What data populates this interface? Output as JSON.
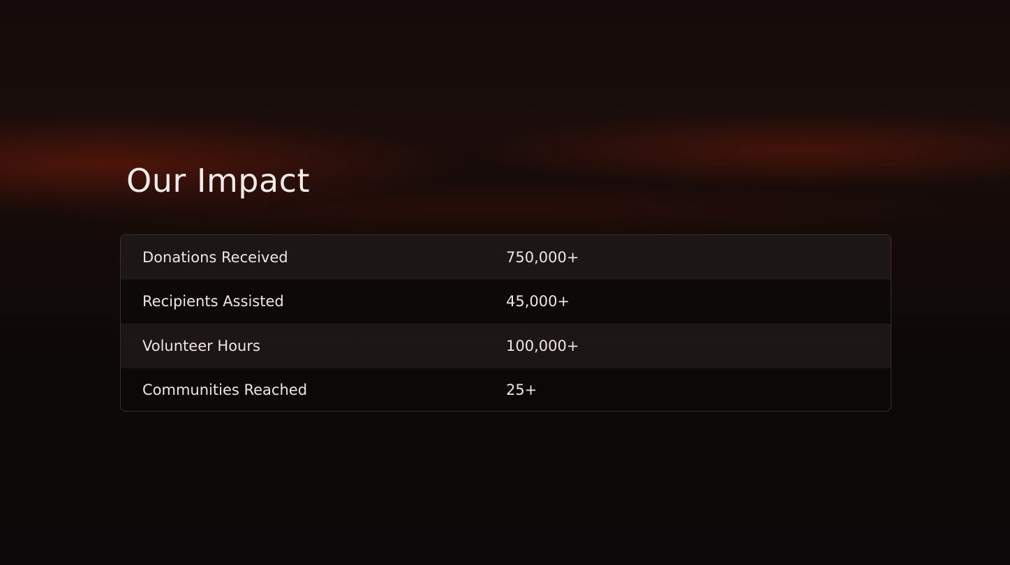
{
  "page": {
    "title": "Our Impact"
  },
  "impact_table": {
    "rows": [
      {
        "label": "Donations Received",
        "value": "750,000+"
      },
      {
        "label": "Recipients Assisted",
        "value": "45,000+"
      },
      {
        "label": "Volunteer Hours",
        "value": "100,000+"
      },
      {
        "label": "Communities Reached",
        "value": "25+"
      }
    ]
  },
  "colors": {
    "text": "#efe6e3",
    "heading": "#f6ebe8",
    "background": "#0b0707",
    "accent_glow": "#781c0a"
  }
}
